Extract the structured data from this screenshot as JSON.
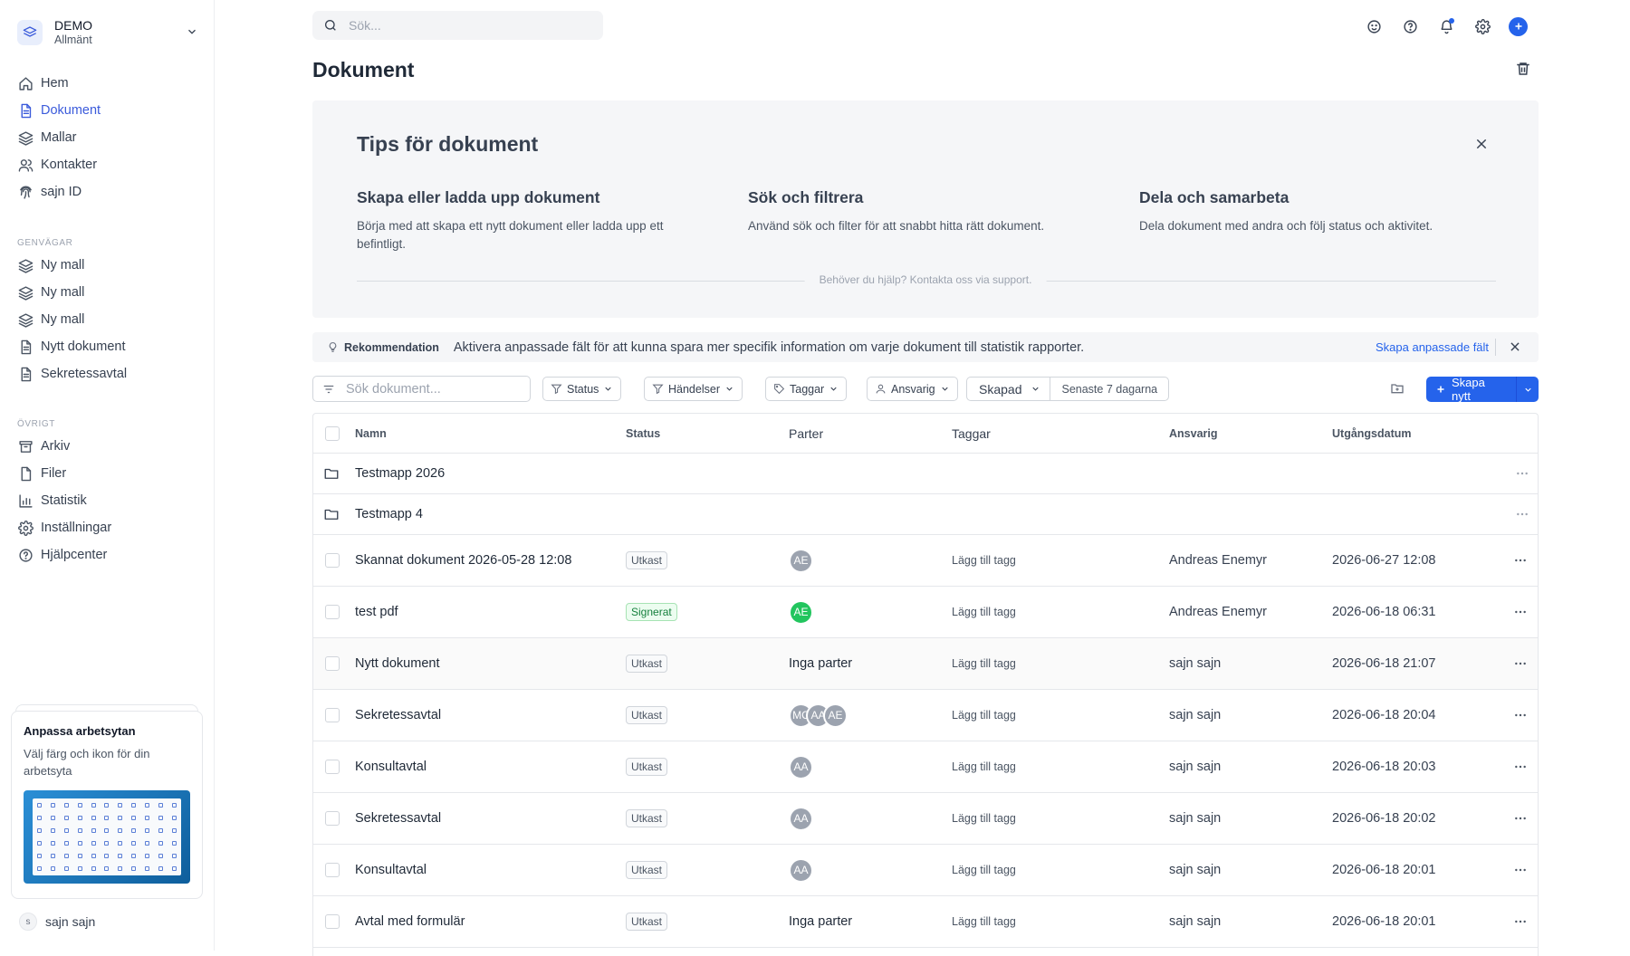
{
  "workspace": {
    "name": "DEMO",
    "sub": "Allmänt"
  },
  "nav": [
    {
      "label": "Hem",
      "icon": "home-icon",
      "active": false
    },
    {
      "label": "Dokument",
      "icon": "document-icon",
      "active": true
    },
    {
      "label": "Mallar",
      "icon": "layers-icon",
      "active": false
    },
    {
      "label": "Kontakter",
      "icon": "users-icon",
      "active": false
    },
    {
      "label": "sajn ID",
      "icon": "fingerprint-icon",
      "active": false
    }
  ],
  "shortcuts": {
    "label": "GENVÄGAR",
    "items": [
      {
        "label": "Ny mall",
        "icon": "layers-icon"
      },
      {
        "label": "Ny mall",
        "icon": "layers-icon"
      },
      {
        "label": "Ny mall",
        "icon": "layers-icon"
      },
      {
        "label": "Nytt dokument",
        "icon": "document-icon"
      },
      {
        "label": "Sekretessavtal",
        "icon": "document-icon"
      }
    ]
  },
  "other": {
    "label": "ÖVRIGT",
    "items": [
      {
        "label": "Arkiv",
        "icon": "archive-icon"
      },
      {
        "label": "Filer",
        "icon": "file-icon"
      },
      {
        "label": "Statistik",
        "icon": "chart-icon"
      },
      {
        "label": "Inställningar",
        "icon": "gear-icon"
      },
      {
        "label": "Hjälpcenter",
        "icon": "help-icon"
      }
    ]
  },
  "promo": {
    "title": "Anpassa arbetsytan",
    "text": "Välj färg och ikon för din arbetsyta"
  },
  "user": {
    "initial": "s",
    "name": "sajn sajn"
  },
  "search": {
    "placeholder": "Sök..."
  },
  "page": {
    "title": "Dokument"
  },
  "tips": {
    "title": "Tips för dokument",
    "cols": [
      {
        "h": "Skapa eller ladda upp dokument",
        "p": "Börja med att skapa ett nytt dokument eller ladda upp ett befintligt."
      },
      {
        "h": "Sök och filtrera",
        "p": "Använd sök och filter för att snabbt hitta rätt dokument."
      },
      {
        "h": "Dela och samarbeta",
        "p": "Dela dokument med andra och följ status och aktivitet."
      }
    ],
    "help": "Behöver du hjälp? Kontakta oss via support."
  },
  "reco": {
    "label": "Rekommendation",
    "text": "Aktivera anpassade fält för att kunna spara mer specifik information om varje dokument till statistik rapporter.",
    "link": "Skapa anpassade fält"
  },
  "toolbar": {
    "search_placeholder": "Sök dokument...",
    "filters": [
      "Status",
      "Händelser",
      "Taggar",
      "Ansvarig"
    ],
    "created_label": "Skapad",
    "created_range": "Senaste 7 dagarna",
    "create_label": "Skapa nytt"
  },
  "table": {
    "headers": [
      "Namn",
      "Status",
      "Parter",
      "Taggar",
      "Ansvarig",
      "Utgångsdatum"
    ],
    "folders": [
      "Testmapp 2026",
      "Testmapp 4"
    ],
    "rows": [
      {
        "name": "Skannat dokument 2026-05-28 12:08",
        "status": "Utkast",
        "parties": [
          "AE"
        ],
        "tag": "Lägg till tagg",
        "owner": "Andreas Enemyr",
        "date": "2026-06-27 12:08"
      },
      {
        "name": "test pdf",
        "status": "Signerat",
        "parties": [
          "AE"
        ],
        "tag": "Lägg till tagg",
        "owner": "Andreas Enemyr",
        "date": "2026-06-18 06:31"
      },
      {
        "name": "Nytt dokument",
        "status": "Utkast",
        "parties_text": "Inga parter",
        "tag": "Lägg till tagg",
        "owner": "sajn sajn",
        "date": "2026-06-18 21:07"
      },
      {
        "name": "Sekretessavtal",
        "status": "Utkast",
        "parties": [
          "MC",
          "AA",
          "AE"
        ],
        "tag": "Lägg till tagg",
        "owner": "sajn sajn",
        "date": "2026-06-18 20:04"
      },
      {
        "name": "Konsultavtal",
        "status": "Utkast",
        "parties": [
          "AA"
        ],
        "tag": "Lägg till tagg",
        "owner": "sajn sajn",
        "date": "2026-06-18 20:03"
      },
      {
        "name": "Sekretessavtal",
        "status": "Utkast",
        "parties": [
          "AA"
        ],
        "tag": "Lägg till tagg",
        "owner": "sajn sajn",
        "date": "2026-06-18 20:02"
      },
      {
        "name": "Konsultavtal",
        "status": "Utkast",
        "parties": [
          "AA"
        ],
        "tag": "Lägg till tagg",
        "owner": "sajn sajn",
        "date": "2026-06-18 20:01"
      },
      {
        "name": "Avtal med formulär",
        "status": "Utkast",
        "parties_text": "Inga parter",
        "tag": "Lägg till tagg",
        "owner": "sajn sajn",
        "date": "2026-06-18 20:01"
      }
    ]
  },
  "colors": {
    "accent": "#2563eb",
    "nav_active": "#3b5bdb",
    "signed": "#22c55e"
  }
}
